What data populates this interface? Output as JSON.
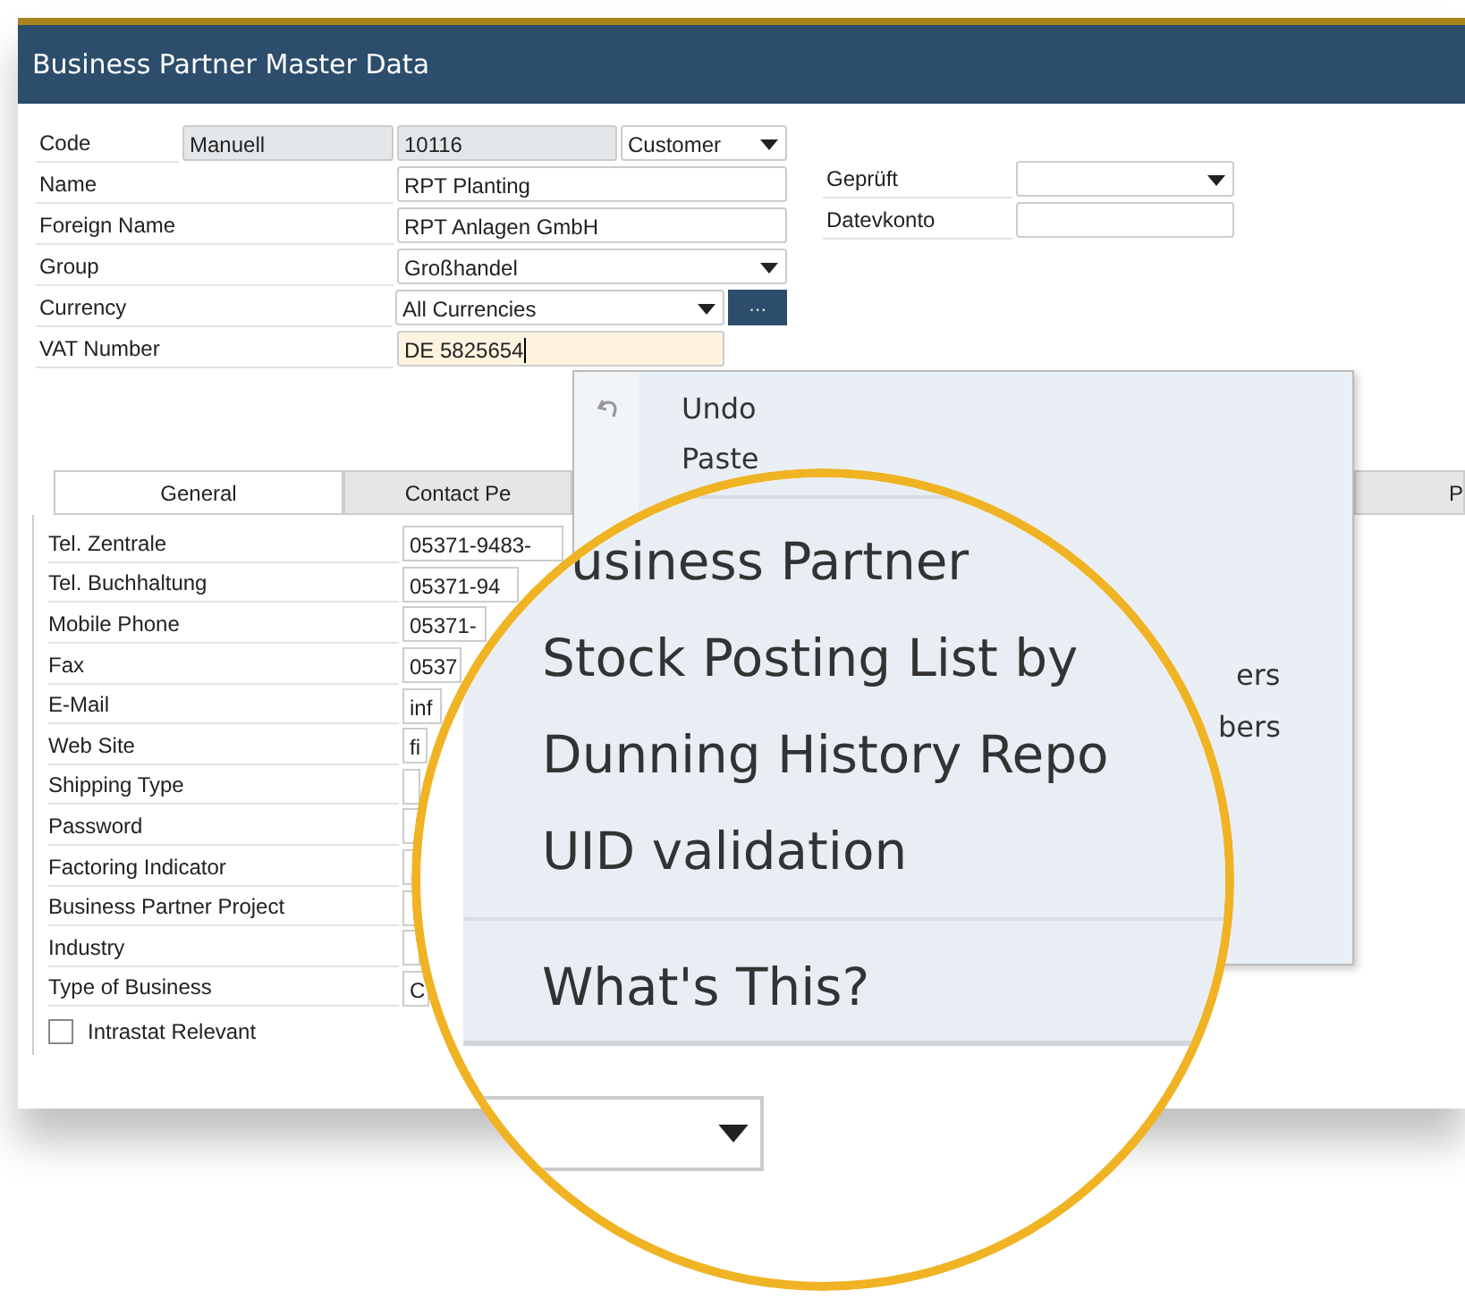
{
  "window": {
    "title": "Business Partner Master Data"
  },
  "header": {
    "code": {
      "label": "Code",
      "series": "Manuell",
      "number": "10116",
      "type": "Customer"
    },
    "rows": [
      {
        "label": "Name",
        "value": "RPT  Planting",
        "kind": "text"
      },
      {
        "label": "Foreign Name",
        "value": "RPT Anlagen GmbH",
        "kind": "text"
      },
      {
        "label": "Group",
        "value": "Großhandel",
        "kind": "dropdown"
      },
      {
        "label": "Currency",
        "value": "All Currencies",
        "kind": "dropdown_button",
        "button": "..."
      },
      {
        "label": "VAT Number",
        "value": "DE 5825654",
        "kind": "focused"
      }
    ]
  },
  "side_fields": [
    {
      "label": "Geprüft",
      "kind": "dropdown"
    },
    {
      "label": "Datevkonto",
      "kind": "text"
    }
  ],
  "tabs": [
    {
      "label": "General",
      "selected": true
    },
    {
      "label": "Contact Pe",
      "selected": false
    },
    {
      "label": "P",
      "selected": false
    }
  ],
  "general_rows": [
    {
      "label": "Tel. Zentrale",
      "value": "05371-9483-"
    },
    {
      "label": "Tel. Buchhaltung",
      "value": "05371-94"
    },
    {
      "label": "Mobile Phone",
      "value": "05371-"
    },
    {
      "label": "Fax",
      "value": "0537"
    },
    {
      "label": "E-Mail",
      "value": "inf"
    },
    {
      "label": "Web Site",
      "value": "fi"
    },
    {
      "label": "Shipping Type"
    },
    {
      "label": "Password"
    },
    {
      "label": "Factoring Indicator"
    },
    {
      "label": "Business Partner Project"
    },
    {
      "label": "Industry"
    },
    {
      "label": "Type of Business",
      "value": "C"
    }
  ],
  "intrastat": {
    "label": "Intrastat Relevant",
    "checked": false
  },
  "context_menu": {
    "items": [
      {
        "label": "Undo",
        "kind": "undo"
      },
      {
        "label": "Paste",
        "kind": "plain"
      }
    ],
    "fragments": [
      "ers",
      "bers"
    ]
  },
  "magnifier": {
    "groups": [
      [
        "usiness Partner",
        "Stock Posting List by",
        "Dunning History Repo",
        "UID validation"
      ],
      [
        "What's This?"
      ]
    ]
  }
}
